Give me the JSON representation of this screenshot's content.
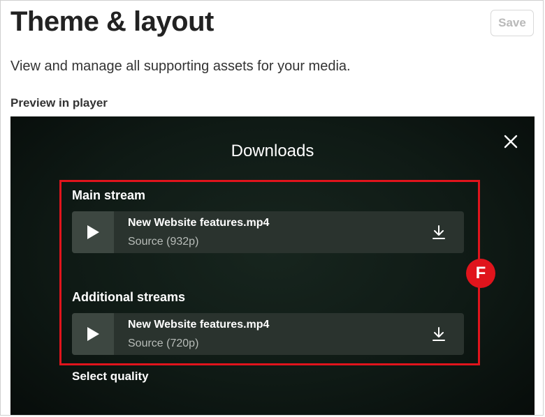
{
  "header": {
    "title": "Theme & layout",
    "save_label": "Save",
    "subtitle": "View and manage all supporting assets for your media.",
    "preview_label": "Preview in player"
  },
  "player": {
    "dialog_title": "Downloads",
    "close_icon": "close-icon",
    "annotation_badge": "F",
    "main_stream": {
      "label": "Main stream",
      "file_name": "New Website features.mp4",
      "source": "Source (932p)"
    },
    "additional_streams": {
      "label": "Additional streams",
      "file_name": "New Website features.mp4",
      "source": "Source (720p)"
    },
    "select_quality": "Select quality"
  },
  "colors": {
    "accent_red": "#e0141c",
    "player_bg": "#0f1a15",
    "card_bg": "#2a332e"
  }
}
